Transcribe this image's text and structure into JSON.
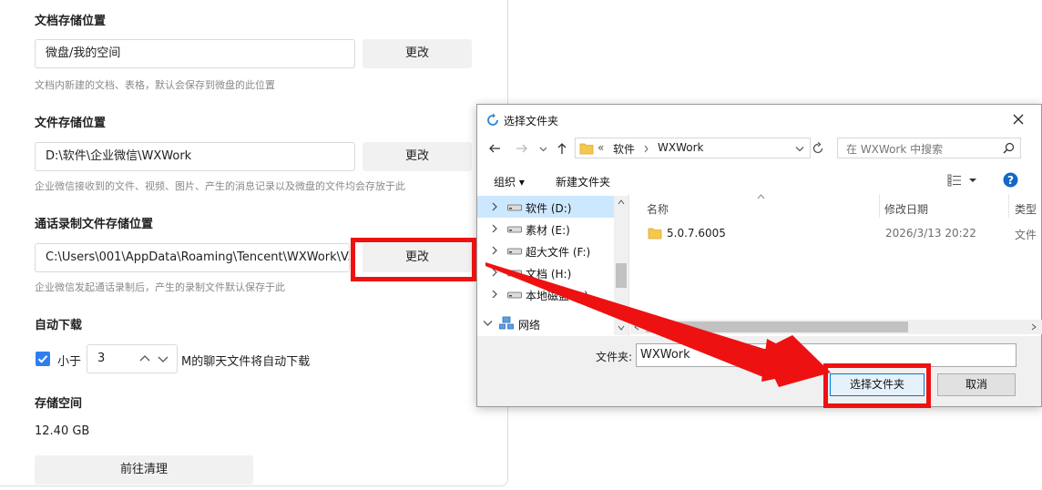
{
  "settings": {
    "doc_storage": {
      "title": "文档存储位置",
      "path": "微盘/我的空间",
      "button": "更改",
      "hint": "文档内新建的文档、表格，默认会保存到微盘的此位置"
    },
    "file_storage": {
      "title": "文件存储位置",
      "path": "D:\\软件\\企业微信\\WXWork",
      "button": "更改",
      "hint": "企业微信接收到的文件、视频、图片、产生的消息记录以及微盘的文件均会存放于此"
    },
    "call_recording": {
      "title": "通话录制文件存储位置",
      "path": "C:\\Users\\001\\AppData\\Roaming\\Tencent\\WXWork\\V...",
      "button": "更改",
      "hint": "企业微信发起通话录制后，产生的录制文件默认保存于此"
    },
    "auto_download": {
      "title": "自动下载",
      "checkbox_checked": true,
      "prefix": "小于",
      "value": "3",
      "suffix": "M的聊天文件将自动下载"
    },
    "storage": {
      "title": "存储空间",
      "size": "12.40 GB",
      "button": "前往清理"
    }
  },
  "dialog": {
    "title": "选择文件夹",
    "address": {
      "prefix": "«",
      "segments": [
        "软件",
        "WXWork"
      ]
    },
    "search_placeholder": "在 WXWork 中搜索",
    "toolbar": {
      "organize": "组织 ▾",
      "new_folder": "新建文件夹"
    },
    "tree": [
      {
        "label": "软件 (D:)",
        "selected": true
      },
      {
        "label": "素材 (E:)",
        "selected": false
      },
      {
        "label": "超大文件 (F:)",
        "selected": false
      },
      {
        "label": "文档 (H:)",
        "selected": false
      },
      {
        "label": "本地磁盘 (J:)",
        "selected": false
      },
      {
        "label": "网络",
        "selected": false
      }
    ],
    "columns": [
      "名称",
      "修改日期",
      "类型"
    ],
    "rows": [
      {
        "name": "5.0.7.6005",
        "date": "2026/3/13 20:22",
        "type": "文件"
      }
    ],
    "folder_label": "文件夹:",
    "folder_value": "WXWork",
    "select_button": "选择文件夹",
    "cancel_button": "取消"
  },
  "colors": {
    "accent": "#2f7ef0",
    "annotation": "#ee1111",
    "selection": "#cce8ff",
    "folder": "#f5c84c"
  }
}
